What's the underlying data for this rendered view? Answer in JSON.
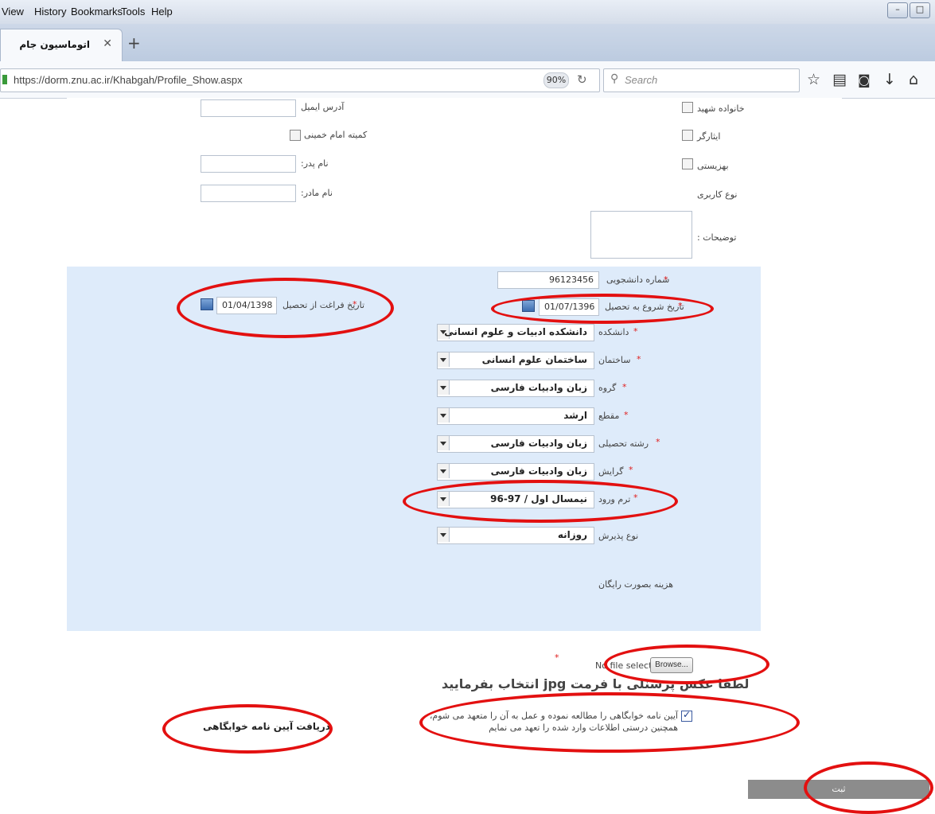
{
  "browser": {
    "menu": [
      "View",
      "History",
      "Bookmarks",
      "Tools",
      "Help"
    ],
    "tab_title": "اتوماسیون جام",
    "url": "https://dorm.znu.ac.ir/Khabgah/Profile_Show.aspx",
    "zoom": "90%",
    "search_placeholder": "Search",
    "window_buttons": [
      "–",
      "□"
    ]
  },
  "form": {
    "email_label": "آدرس ایمیل",
    "imam_committee_label": "کمیته امام خمینی",
    "father_name_label": "نام پدر:",
    "mother_name_label": "نام مادر:",
    "martyr_family_label": "خانواده شهید",
    "veteran_label": "ایثارگر",
    "welfare_label": "بهزیستی",
    "user_type_label": "نوع کاربری",
    "description_label": "توضیحات :",
    "student_number_label": "شماره دانشجویی",
    "student_number_value": "96123456",
    "start_date_label": "تاریخ شروع به تحصیل",
    "start_date_value": "01/07/1396",
    "graduation_date_label": "تاریخ فراغت از تحصیل",
    "graduation_date_value": "01/04/1398",
    "faculty_label": "دانشکده",
    "faculty_value": "دانشکده ادبیات و علوم انسانی",
    "building_label": "ساختمان",
    "building_value": "ساختمان علوم انسانی",
    "group_label": "گروه",
    "group_value": "زبان وادبیات فارسی",
    "level_label": "مقطع",
    "level_value": "ارشد",
    "major_label": "رشته تحصیلی",
    "major_value": "زبان وادبیات فارسی",
    "specialization_label": "گرایش",
    "specialization_value": "زبان وادبیات فارسی",
    "entry_term_label": "ترم ورود",
    "entry_term_value": "نیمسال اول / 97-96",
    "admission_type_label": "نوع پذیرش",
    "admission_type_value": "روزانه",
    "fee_text": "هزینه بصورت رایگان",
    "required_mark": "*",
    "browse_label": "Browse...",
    "no_file_text": "No file selected.",
    "photo_instruction": "لطفا عکس پرسنلی با فرمت jpg انتخاب بفرمایید",
    "agreement_line1": "آیین نامه خوابگاهی را مطالعه نموده و عمل به آن را متعهد می شوم،",
    "agreement_line2": "همچنین درستی اطلاعات وارد شده را تعهد می نمایم",
    "download_regulations": "دریافت آیین نامه خوابگاهی",
    "submit_label": "ثبت"
  },
  "annotation_color": "#e31010",
  "panel_color": "#deebfa"
}
